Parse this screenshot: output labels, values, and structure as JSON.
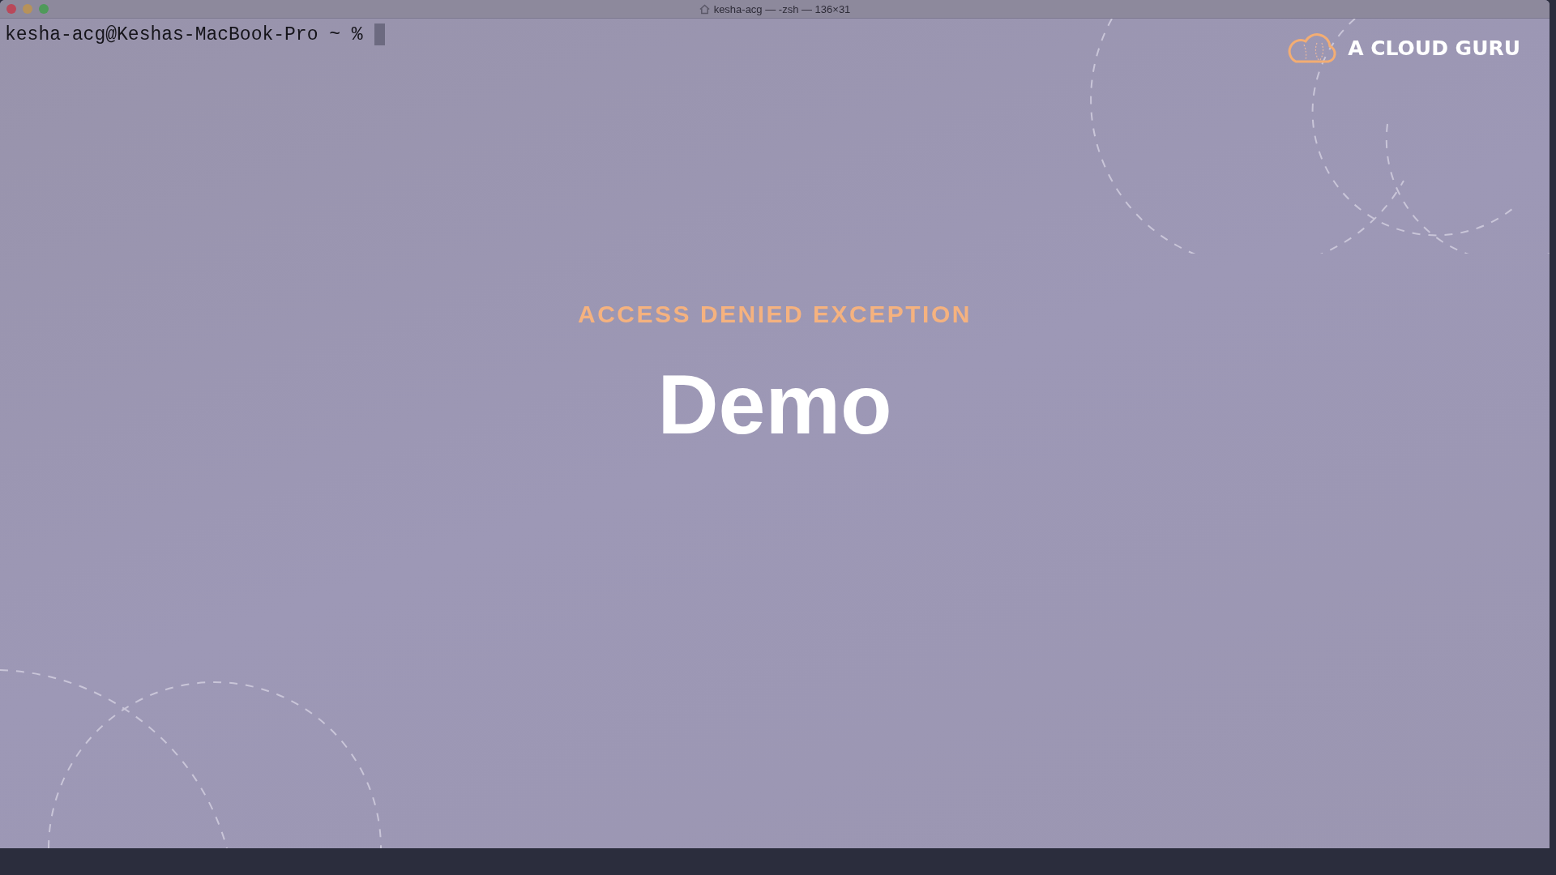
{
  "window": {
    "title": "kesha-acg — -zsh — 136×31"
  },
  "terminal": {
    "prompt": "kesha-acg@Keshas-MacBook-Pro ~ %"
  },
  "slide": {
    "logo_text": "A CLOUD GURU",
    "subtitle": "ACCESS DENIED EXCEPTION",
    "heading": "Demo"
  }
}
